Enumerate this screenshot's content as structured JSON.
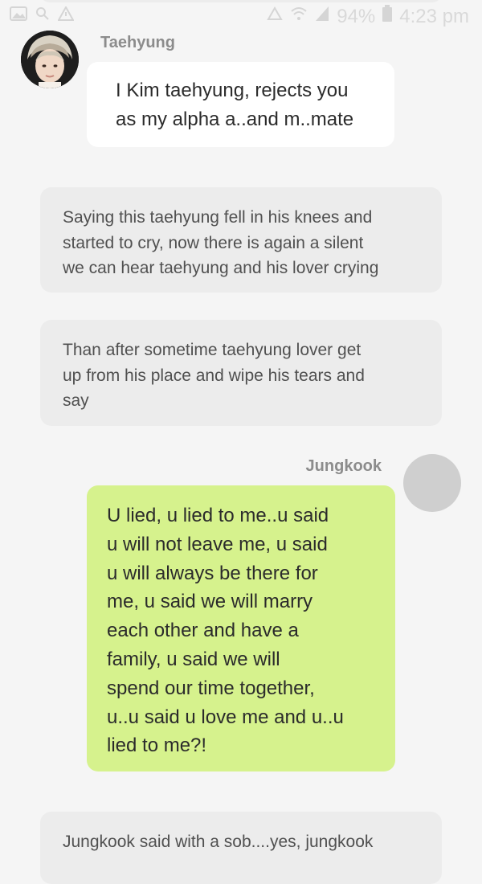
{
  "status_bar": {
    "battery": "94%",
    "time": "4:23 pm",
    "icons": [
      "gallery-icon",
      "search-icon",
      "alert-icon",
      "no-sim-icon",
      "wifi-icon",
      "signal-icon",
      "battery-icon"
    ]
  },
  "messages": [
    {
      "speaker": "Taehyung",
      "lines": [
        "I Kim taehyung, rejects you",
        "as my alpha a..and m..mate"
      ]
    },
    {
      "speaker": "Jungkook",
      "lines": [
        "U lied, u lied to me..u said",
        "u will not leave me, u said",
        "u will always be there for",
        "me, u said we will marry",
        "each other and have a",
        "family, u said we will",
        "spend our time together,",
        "u..u said u love me and u..u",
        "lied to me?!"
      ]
    }
  ],
  "narrations": [
    {
      "lines": [
        "Saying this taehyung fell in his knees and",
        "started to cry, now there is again a silent",
        "we can hear taehyung and his lover crying"
      ]
    },
    {
      "lines": [
        "Than after sometime taehyung lover get",
        "up from his place and wipe his tears and",
        "say"
      ]
    },
    {
      "lines": [
        "Jungkook said with a sob....yes, jungkook"
      ]
    }
  ],
  "colors": {
    "background": "#f5f5f5",
    "narration_bubble": "#ececec",
    "left_bubble": "#ffffff",
    "right_bubble": "#d6f28d",
    "speaker_name": "#8c8c8c"
  }
}
